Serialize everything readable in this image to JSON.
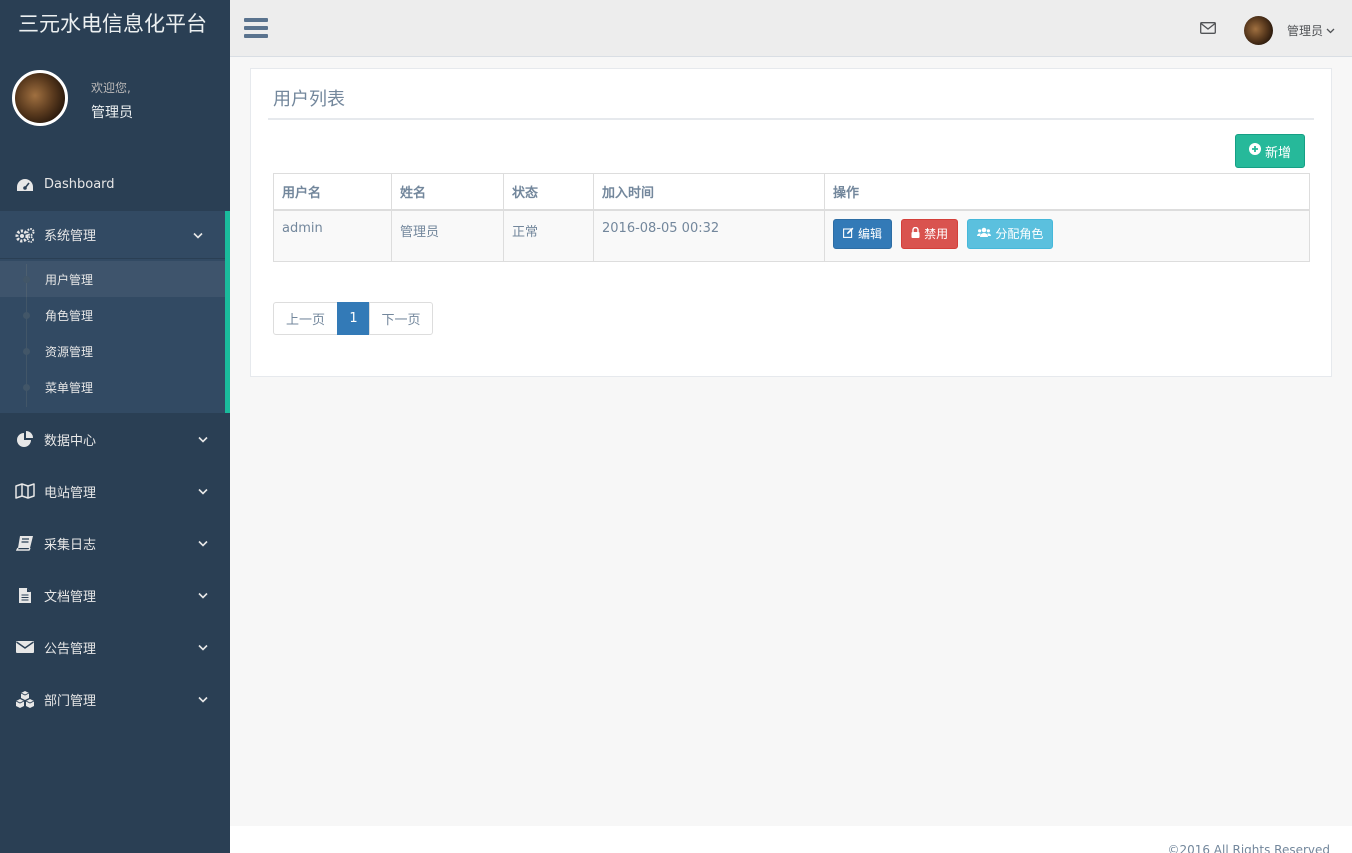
{
  "app_title": "三元水电信息化平台",
  "profile": {
    "welcome": "欢迎您,",
    "name": "管理员"
  },
  "nav": {
    "dashboard": "Dashboard",
    "system": {
      "label": "系统管理",
      "children": [
        "用户管理",
        "角色管理",
        "资源管理",
        "菜单管理"
      ],
      "active_child": "用户管理"
    },
    "data_center": "数据中心",
    "station": "电站管理",
    "collect_log": "采集日志",
    "docs": "文档管理",
    "notice": "公告管理",
    "dept": "部门管理"
  },
  "topbar": {
    "user_name": "管理员"
  },
  "panel": {
    "title": "用户列表",
    "add_label": "新增",
    "columns": [
      "用户名",
      "姓名",
      "状态",
      "加入时间",
      "操作"
    ],
    "rows": [
      {
        "username": "admin",
        "name": "管理员",
        "status": "正常",
        "joined": "2016-08-05 00:32"
      }
    ],
    "actions": {
      "edit": "编辑",
      "disable": "禁用",
      "assign_role": "分配角色"
    }
  },
  "pagination": {
    "prev": "上一页",
    "current": "1",
    "next": "下一页"
  },
  "footer": "©2016 All Rights Reserved",
  "colors": {
    "sidebar": "#2A3F54",
    "accent": "#1ABB9C",
    "primary": "#337AB7",
    "danger": "#D9534F",
    "info": "#5BC0DE",
    "success": "#26B99A"
  }
}
